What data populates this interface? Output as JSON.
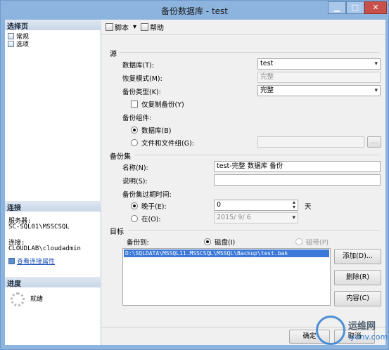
{
  "window": {
    "title": "备份数据库 - test",
    "minimize_glyph": "▁",
    "maximize_glyph": "□",
    "close_glyph": "✕"
  },
  "left": {
    "select_page": "选择页",
    "pages": [
      "常规",
      "选项"
    ],
    "connection_header": "连接",
    "server_label": "服务器:",
    "server_value": "SC-SQL01\\MSSCSQL",
    "conn_label": "连接:",
    "conn_value": "CLOUDLAB\\cloudadmin",
    "view_props": "查看连接属性",
    "progress_header": "进度",
    "progress_status": "就绪"
  },
  "toolbar": {
    "script": "脚本",
    "script_caret": "▾",
    "help": "帮助"
  },
  "source": {
    "section": "源",
    "database_label": "数据库(T):",
    "database_value": "test",
    "recovery_label": "恢复模式(M):",
    "recovery_value": "完整",
    "backup_type_label": "备份类型(K):",
    "backup_type_value": "完整",
    "copy_only": "仅复制备份(Y)",
    "component_label": "备份组件:",
    "comp_db": "数据库(B)",
    "comp_files": "文件和文件组(G):",
    "browse": "..."
  },
  "backup_set": {
    "section": "备份集",
    "name_label": "名称(N):",
    "name_value": "test-完整 数据库 备份",
    "desc_label": "说明(S):",
    "desc_value": "",
    "expire_label": "备份集过期时间:",
    "after_label": "晚于(E):",
    "after_value": "0",
    "after_unit": "天",
    "on_label": "在(O):",
    "on_value": "2015/ 9/ 6"
  },
  "destination": {
    "section": "目标",
    "backup_to": "备份到:",
    "disk": "磁盘(I)",
    "tape": "磁带(P)",
    "paths": [
      "D:\\SQLDATA\\MSSQL11.MSSCSQL\\MSSQL\\Backup\\test.bak"
    ],
    "add": "添加(D)...",
    "remove": "删除(R)",
    "contents": "内容(C)"
  },
  "footer": {
    "ok": "确定",
    "cancel": "取消"
  },
  "watermark": {
    "line1": "运维网",
    "line2": "iyunv.com"
  },
  "colors": {
    "accent": "#3b78d8",
    "titlebar": "#8db4de",
    "close": "#c7514a"
  }
}
